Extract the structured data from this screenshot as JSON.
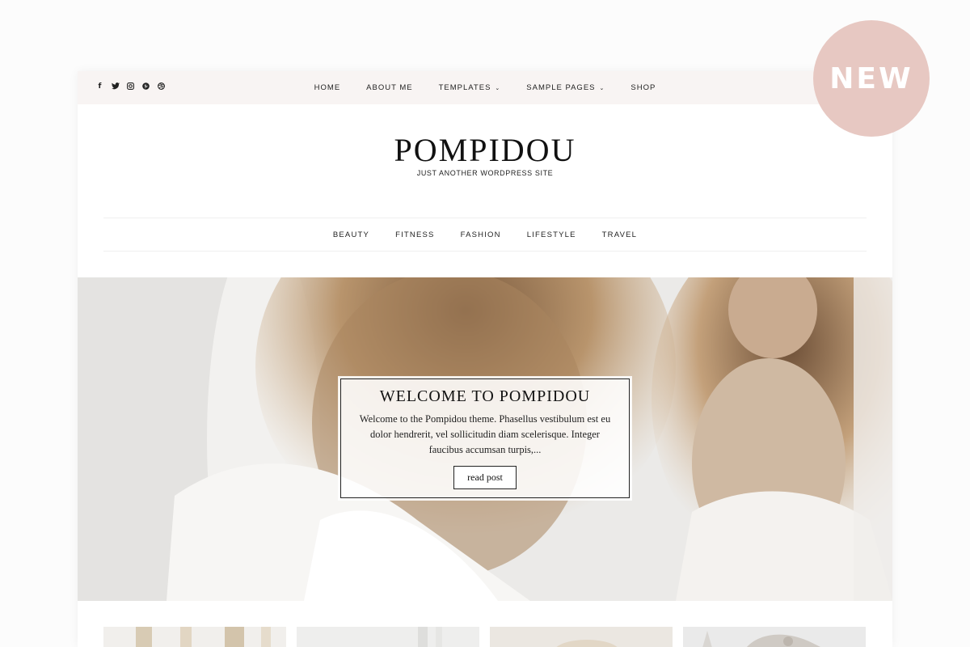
{
  "top_nav": {
    "social_icons": [
      "facebook-icon",
      "twitter-icon",
      "instagram-icon",
      "pinterest-icon",
      "dribbble-icon"
    ],
    "items": [
      {
        "label": "HOME",
        "dropdown": false
      },
      {
        "label": "ABOUT ME",
        "dropdown": false
      },
      {
        "label": "TEMPLATES",
        "dropdown": true
      },
      {
        "label": "SAMPLE PAGES",
        "dropdown": true
      },
      {
        "label": "SHOP",
        "dropdown": false
      }
    ]
  },
  "site": {
    "title": "POMPIDOU",
    "tagline": "JUST ANOTHER WORDPRESS SITE"
  },
  "category_nav": {
    "items": [
      "BEAUTY",
      "FITNESS",
      "FASHION",
      "LIFESTYLE",
      "TRAVEL"
    ]
  },
  "featured_post": {
    "title": "WELCOME TO POMPIDOU",
    "excerpt": "Welcome to the Pompidou theme. Phasellus vestibulum est eu dolor hendrerit, vel sollicitudin diam scelerisque. Integer faucibus accumsan turpis,...",
    "button_label": "read post"
  },
  "badge": {
    "label": "NEW"
  },
  "colors": {
    "topbar_bg": "#f8f4f3",
    "badge_bg": "#e7c8c2",
    "text": "#222222"
  }
}
